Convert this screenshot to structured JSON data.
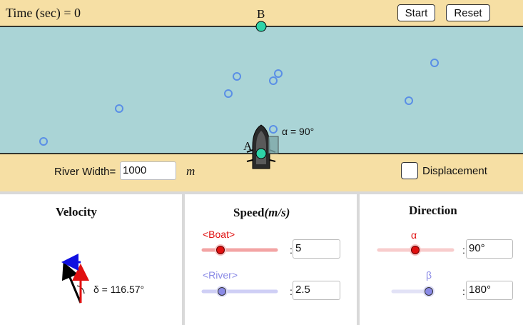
{
  "header": {
    "time_label": "Time (sec) = 0",
    "start_label": "Start",
    "reset_label": "Reset"
  },
  "scene": {
    "point_b": "B",
    "point_a": "A",
    "alpha_label": "α = 90°",
    "river_width_label": "River Width=",
    "river_width_value": "1000",
    "unit": "m",
    "displacement_label": "Displacement",
    "displacement_checked": false,
    "river_color": "#aad4d6",
    "bank_color": "#f6dfa4"
  },
  "velocity": {
    "title": "Velocity",
    "delta_label": "δ = 116.57°"
  },
  "speed": {
    "title_main": "Speed",
    "title_unit": "(m/s)",
    "boat_label": "<Boat>",
    "boat_value": "5",
    "river_label": "<River>",
    "river_value": "2.5",
    "colon": ":",
    "boat_color": "#e01010",
    "river_color": "#8a8ae6"
  },
  "direction": {
    "title": "Direction",
    "alpha_symbol": "α",
    "alpha_value": "90°",
    "beta_symbol": "β",
    "beta_value": "180°",
    "colon": ":"
  }
}
